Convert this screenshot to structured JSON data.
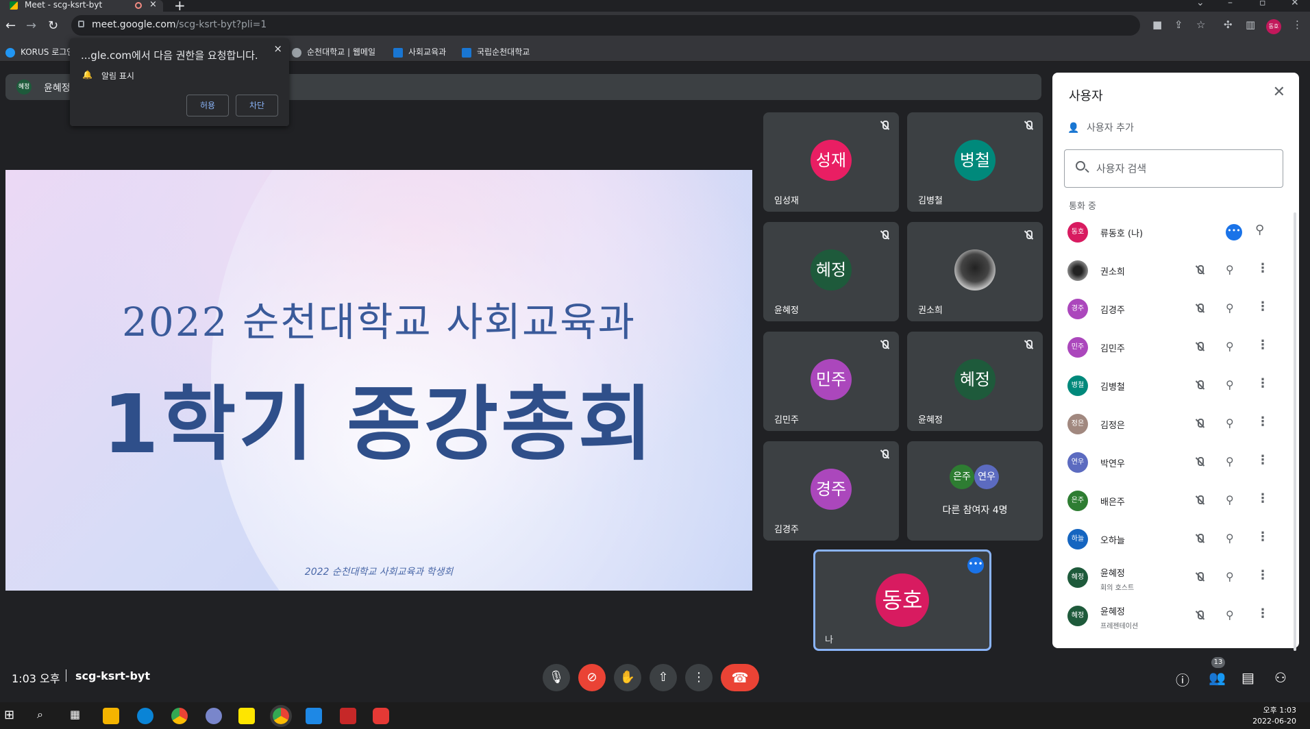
{
  "browser": {
    "tab_title": "Meet - scg-ksrt-byt",
    "tab_close": "×",
    "new_tab": "+",
    "url_host": "meet.google.com",
    "url_path": "/scg-ksrt-byt?pli=1",
    "bookmarks": [
      {
        "label": "KORUS 로그인"
      },
      {
        "label": "순천대학교 | 웹메일"
      },
      {
        "label": "사회교육과"
      },
      {
        "label": "국립순천대학교"
      }
    ],
    "profile_initials": "동호"
  },
  "permission_popup": {
    "text": "...gle.com에서 다음 권한을 요청합니다.",
    "close": "×",
    "item": "알림 표시",
    "allow": "허용",
    "block": "차단"
  },
  "presenter_bar": {
    "avatar": "혜정",
    "name": "윤혜정"
  },
  "slide": {
    "line1": "2022 순천대학교 사회교육과",
    "line2": "1학기 종강총회",
    "footer": "2022 순천대학교 사회교육과 학생회"
  },
  "tiles": [
    {
      "initial": "성재",
      "name": "임성재",
      "color": "#e91e63"
    },
    {
      "initial": "병철",
      "name": "김병철",
      "color": "#00897b"
    },
    {
      "initial": "혜정",
      "name": "윤혜정",
      "color": "#1e5a3b"
    },
    {
      "initial": "",
      "name": "권소희",
      "color": "#555555"
    },
    {
      "initial": "민주",
      "name": "김민주",
      "color": "#ab47bc"
    },
    {
      "initial": "혜정",
      "name": "윤혜정",
      "color": "#1e5a3b"
    },
    {
      "initial": "경주",
      "name": "김경주",
      "color": "#ab47bc"
    }
  ],
  "others_tile": {
    "avatar1": "은주",
    "avatar2": "연우",
    "label": "다른 참여자 4명"
  },
  "self_tile": {
    "initial": "동호",
    "name": "나"
  },
  "bottom": {
    "time": "1:03 오후",
    "code": "scg-ksrt-byt",
    "people_count": "13"
  },
  "panel": {
    "title": "사용자",
    "add_people": "사용자 추가",
    "search_placeholder": "사용자 검색",
    "section": "통화 중",
    "participants": [
      {
        "initial": "동호",
        "name": "류동호 (나)",
        "sub": "",
        "color": "#d81b60"
      },
      {
        "initial": "",
        "name": "권소희",
        "sub": "",
        "color": "#555555"
      },
      {
        "initial": "경주",
        "name": "김경주",
        "sub": "",
        "color": "#ab47bc"
      },
      {
        "initial": "민주",
        "name": "김민주",
        "sub": "",
        "color": "#ab47bc"
      },
      {
        "initial": "병철",
        "name": "김병철",
        "sub": "",
        "color": "#00897b"
      },
      {
        "initial": "정은",
        "name": "김정은",
        "sub": "",
        "color": "#a1887f"
      },
      {
        "initial": "연우",
        "name": "박연우",
        "sub": "",
        "color": "#5c6bc0"
      },
      {
        "initial": "은주",
        "name": "배은주",
        "sub": "",
        "color": "#2e7d32"
      },
      {
        "initial": "하늘",
        "name": "오하늘",
        "sub": "",
        "color": "#1565c0"
      },
      {
        "initial": "혜정",
        "name": "윤혜정",
        "sub": "회의 호스트",
        "color": "#1e5a3b"
      },
      {
        "initial": "혜정",
        "name": "윤혜정",
        "sub": "프레젠테이션",
        "color": "#1e5a3b"
      }
    ]
  },
  "taskbar": {
    "clock_time": "오후 1:03",
    "clock_date": "2022-06-20"
  }
}
